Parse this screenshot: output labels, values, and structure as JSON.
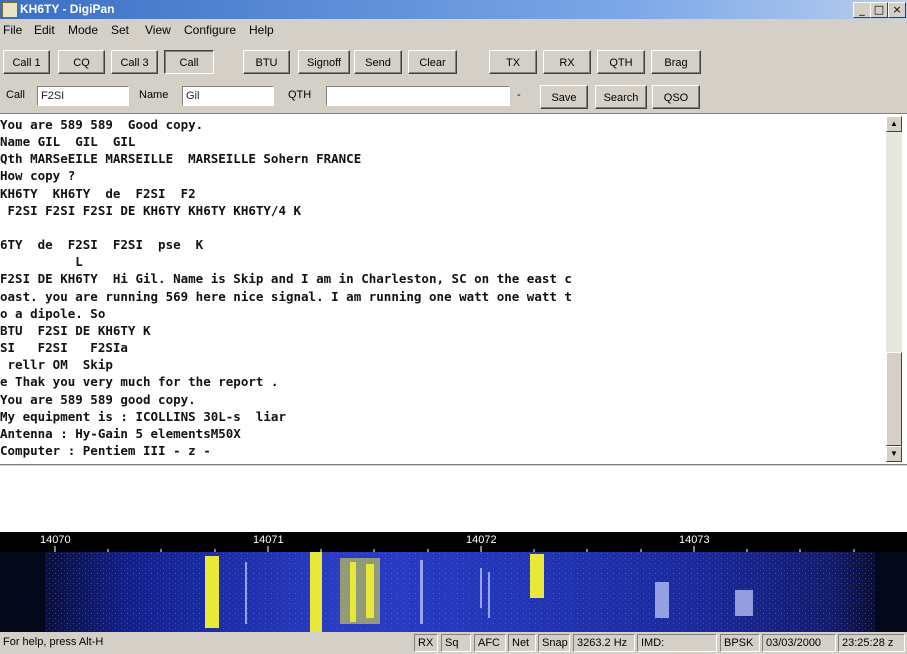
{
  "window": {
    "title": "KH6TY - DigiPan",
    "minimize": "_",
    "maximize": "□",
    "close": "×"
  },
  "menu": [
    "File",
    "Edit",
    "Mode",
    "Set",
    "View",
    "Configure",
    "Help"
  ],
  "toolbar1": [
    "Call 1",
    "CQ",
    "Call 3",
    "Call",
    "BTU",
    "Signoff",
    "Send",
    "Clear",
    "TX",
    "RX",
    "QTH",
    "Brag"
  ],
  "toolbar2": {
    "call_label": "Call",
    "call_value": "F2SI",
    "name_label": "Name",
    "name_value": "Gil",
    "qth_label": "QTH",
    "qth_value": "",
    "dash": "-",
    "buttons": [
      "Save",
      "Search",
      "QSO"
    ]
  },
  "receive_text": [
    "You are 589 589  Good copy.",
    "Name GIL  GIL  GIL",
    "Qth MARSeEILE MARSEILLE  MARSEILLE Sohern FRANCE",
    "How copy ?",
    "KH6TY  KH6TY  de  F2SI  F2",
    " F2SI F2SI F2SI DE KH6TY KH6TY KH6TY/4 K",
    "",
    "6TY  de  F2SI  F2SI  pse  K",
    "          L",
    "F2SI DE KH6TY  Hi Gil. Name is Skip and I am in Charleston, SC on the east c",
    "oast. you are running 569 here nice signal. I am running one watt one watt t",
    "o a dipole. So",
    "BTU  F2SI DE KH6TY K",
    "SI   F2SI   F2SIa",
    " rellr OM  Skip",
    "e Thak you very much for the report .",
    "You are 589 589 good copy.",
    "My equipment is : ICOLLINS 30L-s  liar",
    "Antenna : Hy-Gain 5 elementsM50X",
    "Computer : Pentiem III - z -"
  ],
  "waterfall": {
    "freq_labels": [
      "14070",
      "14071",
      "14072",
      "14073"
    ]
  },
  "status": {
    "help": "For help, press Alt-H",
    "rx": "RX",
    "sq": "Sq",
    "afc": "AFC",
    "net": "Net",
    "snap": "Snap",
    "freq": "3263.2 Hz",
    "imd": "IMD:",
    "mode": "BPSK",
    "date": "03/03/2000",
    "time": "23:25:28 z"
  }
}
